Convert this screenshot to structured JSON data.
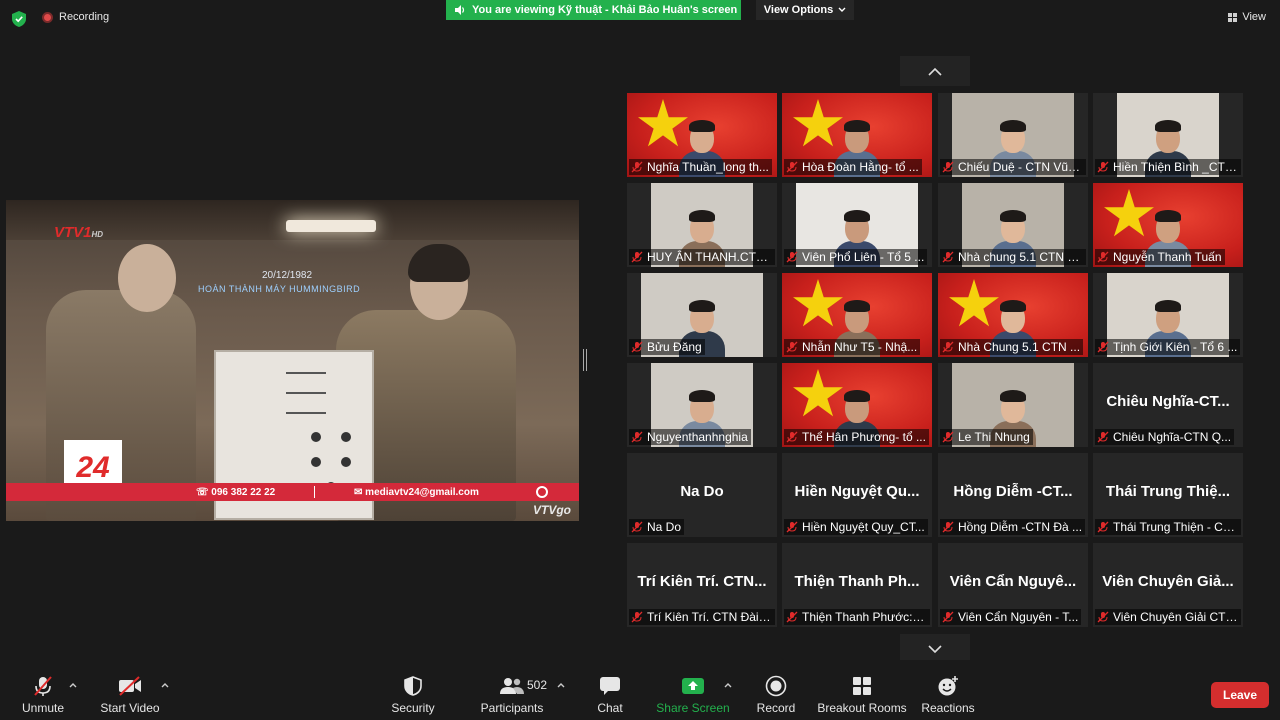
{
  "topbar": {
    "recording_label": "Recording",
    "viewing_banner": "You are viewing Kỹ thuật - Khải Bảo Huân's screen",
    "view_options_label": "View Options",
    "view_label": "View"
  },
  "shared_screen": {
    "channel_logo": "VTV1",
    "channel_logo_hd": "HD",
    "caption_date": "20/12/1982",
    "caption_text": "HOÀN THÀNH MÁY HUMMINGBIRD",
    "badge": "24",
    "phone": "096 382 22 22",
    "email": "mediavtv24@gmail.com",
    "corner_logo": "VTVgo"
  },
  "gallery": {
    "tiles": [
      {
        "name": "Nghĩa Thuần_long th...",
        "type": "flag-cam"
      },
      {
        "name": "Hòa Đoàn Hằng- tổ ...",
        "type": "flag-cam"
      },
      {
        "name": "Chiếu Duệ - CTN Vũn...",
        "type": "cam"
      },
      {
        "name": "Hiền Thiện Bình _CTN ...",
        "type": "cam"
      },
      {
        "name": "HUY ÂN THANH.CTN ...",
        "type": "cam"
      },
      {
        "name": "Viên Phổ Liên - Tổ 5 ...",
        "type": "cam"
      },
      {
        "name": "Nhà chung 5.1 CTN H...",
        "type": "cam"
      },
      {
        "name": "Nguyễn Thanh Tuấn",
        "type": "flag-cam"
      },
      {
        "name": "Bửu Đăng",
        "type": "cam"
      },
      {
        "name": "Nhẫn Như T5 - Nhậ...",
        "type": "flag-cam"
      },
      {
        "name": "Nhà Chung 5.1 CTN ...",
        "type": "flag-cam"
      },
      {
        "name": "Tịnh Giới Kiên - Tổ 6 ...",
        "type": "cam"
      },
      {
        "name": "Nguyenthanhnghia",
        "type": "cam"
      },
      {
        "name": "Thể Hân Phương- tổ ...",
        "type": "flag-cam"
      },
      {
        "name": "Le Thi Nhung",
        "type": "cam"
      },
      {
        "name": "Chiêu Nghĩa-CTN Q...",
        "display": "Chiêu Nghĩa-CT...",
        "type": "name"
      },
      {
        "name": "Na Do",
        "display": "Na Do",
        "type": "name"
      },
      {
        "name": "Hiền Nguyệt Quy_CT...",
        "display": "Hiền Nguyệt Qu...",
        "type": "name"
      },
      {
        "name": "Hồng Diễm -CTN Đà ...",
        "display": "Hồng Diễm -CT...",
        "type": "name"
      },
      {
        "name": "Thái Trung Thiện - CT...",
        "display": "Thái Trung Thiệ...",
        "type": "name"
      },
      {
        "name": "Trí Kiên Trí. CTN Đài L...",
        "display": "Trí Kiên Trí. CTN...",
        "type": "name"
      },
      {
        "name": "Thiện Thanh Phước: Đ...",
        "display": "Thiện Thanh Ph...",
        "type": "name"
      },
      {
        "name": "Viên Cẩn Nguyên - T...",
        "display": "Viên Cẩn Nguyê...",
        "type": "name"
      },
      {
        "name": "Viên Chuyên Giải CTN...",
        "display": "Viên Chuyên Giả...",
        "type": "name"
      }
    ]
  },
  "toolbar": {
    "unmute": "Unmute",
    "start_video": "Start Video",
    "security": "Security",
    "participants": "Participants",
    "participant_count": "502",
    "chat": "Chat",
    "share_screen": "Share Screen",
    "record": "Record",
    "breakout_rooms": "Breakout Rooms",
    "reactions": "Reactions",
    "leave": "Leave"
  },
  "colors": {
    "banner_green": "#23b14d",
    "leave_red": "#d42e2e",
    "mic_off_red": "#e02b2b",
    "background": "#1a1a1a",
    "tile_bg": "#262626"
  }
}
